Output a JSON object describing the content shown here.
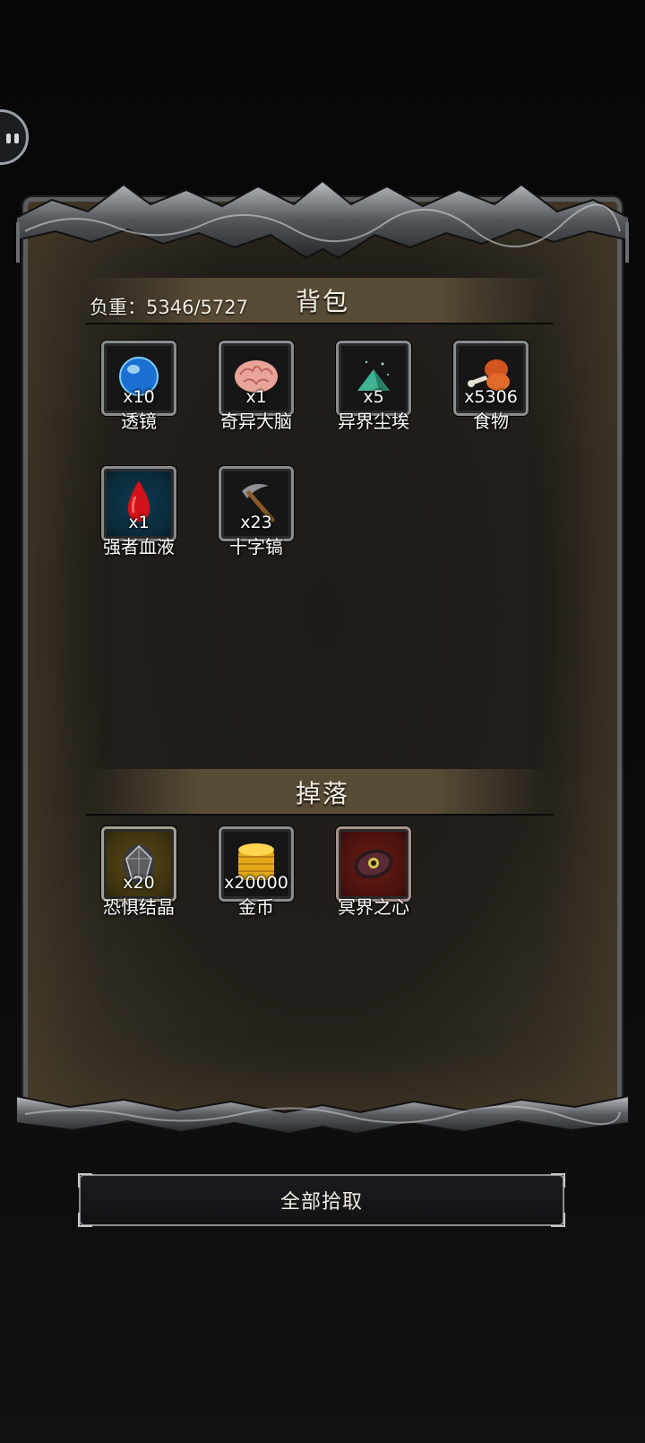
{
  "backpack": {
    "title": "背包",
    "weight_label": "负重：5346/5727",
    "items": [
      {
        "name": "透镜",
        "qty": "x10",
        "icon": "blue-orb-icon"
      },
      {
        "name": "奇异大脑",
        "qty": "x1",
        "icon": "brain-icon"
      },
      {
        "name": "异界尘埃",
        "qty": "x5",
        "icon": "dust-pile-icon"
      },
      {
        "name": "食物",
        "qty": "x5306",
        "icon": "meat-drumstick-icon"
      },
      {
        "name": "强者血液",
        "qty": "x1",
        "icon": "blood-drop-icon"
      },
      {
        "name": "十字镐",
        "qty": "x23",
        "icon": "pickaxe-icon"
      }
    ]
  },
  "drops": {
    "title": "掉落",
    "items": [
      {
        "name": "恐惧结晶",
        "qty": "x20",
        "icon": "crystal-icon"
      },
      {
        "name": "金币",
        "qty": "x20000",
        "icon": "gold-coins-icon"
      },
      {
        "name": "冥界之心",
        "qty": "",
        "icon": "underworld-heart-icon"
      }
    ]
  },
  "actions": {
    "pickup_all": "全部拾取"
  },
  "colors": {
    "frame": "#5b5d60",
    "panel_bg": "#221f1a",
    "header_band": "#5c4e38",
    "slot_border": "#8a8c8f"
  }
}
